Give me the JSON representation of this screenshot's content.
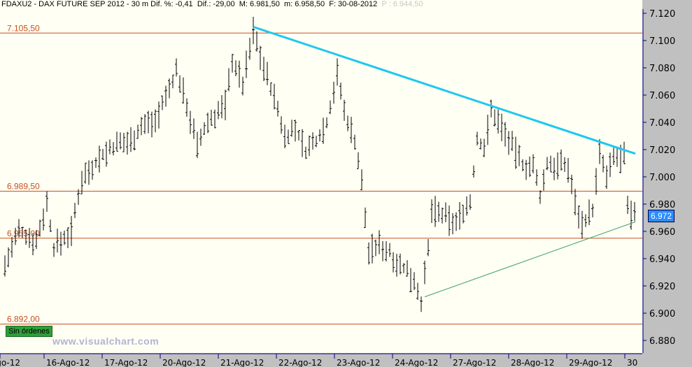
{
  "header": {
    "symbol": "FDAXU2 - DAX FUTURE  SEP 2012 -  30 m",
    "change_pct": "Dif. %: -0,41",
    "change": "Dif.: -29,00",
    "max": "M: 6.981,50",
    "min": "m: 6.958,50",
    "date": "F: 30-08-2012",
    "prev": "P : 6.944,50"
  },
  "orders_badge": "Sin órdenes",
  "watermark": "www.visualchart.com",
  "last_price": "6.972",
  "colors": {
    "bars": "#000000",
    "hline": "#c8501e",
    "resistance": "#1ec8f0",
    "support": "#2e9e5e",
    "bg": "#fffff4"
  },
  "chart_data": {
    "type": "ohlc",
    "ylim": [
      6875,
      7122
    ],
    "y_ticks": [
      {
        "v": 7120,
        "label": "7.120"
      },
      {
        "v": 7100,
        "label": "7.100"
      },
      {
        "v": 7080,
        "label": "7.080"
      },
      {
        "v": 7060,
        "label": "7.060"
      },
      {
        "v": 7040,
        "label": "7.040"
      },
      {
        "v": 7020,
        "label": "7.020"
      },
      {
        "v": 7000,
        "label": "7.000"
      },
      {
        "v": 6980,
        "label": "6.980"
      },
      {
        "v": 6960,
        "label": "6.960"
      },
      {
        "v": 6940,
        "label": "6.940"
      },
      {
        "v": 6920,
        "label": "6.920"
      },
      {
        "v": 6900,
        "label": "6.900"
      },
      {
        "v": 6880,
        "label": "6.880"
      }
    ],
    "x_range": [
      0,
      184
    ],
    "x_ticks": [
      {
        "bar": 0,
        "label": "Ago-12"
      },
      {
        "bar": 12.6,
        "label": "16-Ago-12"
      },
      {
        "bar": 29.2,
        "label": "17-Ago-12"
      },
      {
        "bar": 45.8,
        "label": "20-Ago-12"
      },
      {
        "bar": 62.4,
        "label": "21-Ago-12"
      },
      {
        "bar": 79,
        "label": "22-Ago-12"
      },
      {
        "bar": 95.6,
        "label": "23-Ago-12"
      },
      {
        "bar": 112.2,
        "label": "24-Ago-12"
      },
      {
        "bar": 128.8,
        "label": "27-Ago-12"
      },
      {
        "bar": 145.4,
        "label": "28-Ago-12"
      },
      {
        "bar": 162,
        "label": "29-Ago-12"
      },
      {
        "bar": 178.6,
        "label": "30"
      }
    ],
    "price_path": [
      [
        1,
        6935
      ],
      [
        5,
        6960
      ],
      [
        10,
        6953
      ],
      [
        13,
        6981
      ],
      [
        15,
        6948
      ],
      [
        20,
        6960
      ],
      [
        23,
        6999
      ],
      [
        28,
        7014
      ],
      [
        32,
        7022
      ],
      [
        37,
        7027
      ],
      [
        40,
        7037
      ],
      [
        44,
        7042
      ],
      [
        47,
        7058
      ],
      [
        50,
        7078
      ],
      [
        53,
        7053
      ],
      [
        56,
        7022
      ],
      [
        59,
        7040
      ],
      [
        64,
        7053
      ],
      [
        66,
        7086
      ],
      [
        69,
        7068
      ],
      [
        72,
        7107
      ],
      [
        75,
        7081
      ],
      [
        78,
        7058
      ],
      [
        81,
        7030
      ],
      [
        84,
        7035
      ],
      [
        87,
        7019
      ],
      [
        90,
        7027
      ],
      [
        93,
        7040
      ],
      [
        96,
        7076
      ],
      [
        98,
        7048
      ],
      [
        101,
        7027
      ],
      [
        103,
        6996
      ],
      [
        105,
        6945
      ],
      [
        108,
        6950
      ],
      [
        111,
        6945
      ],
      [
        114,
        6935
      ],
      [
        118,
        6925
      ],
      [
        120,
        6909
      ],
      [
        122,
        6945
      ],
      [
        123,
        6976
      ],
      [
        126,
        6971
      ],
      [
        130,
        6966
      ],
      [
        132,
        6976
      ],
      [
        134,
        6981
      ],
      [
        136,
        7027
      ],
      [
        138,
        7022
      ],
      [
        140,
        7048
      ],
      [
        143,
        7037
      ],
      [
        146,
        7022
      ],
      [
        149,
        7009
      ],
      [
        152,
        7007
      ],
      [
        154,
        6986
      ],
      [
        156,
        7009
      ],
      [
        159,
        7009
      ],
      [
        162,
        7007
      ],
      [
        164,
        6981
      ],
      [
        166,
        6966
      ],
      [
        169,
        6976
      ],
      [
        171,
        7017
      ],
      [
        173,
        6999
      ],
      [
        175,
        7014
      ],
      [
        178,
        7014
      ],
      [
        179,
        6976
      ],
      [
        180,
        6971
      ],
      [
        181,
        6976
      ]
    ],
    "horizontal_lines": [
      {
        "v": 7105.5,
        "label": "7.105,50"
      },
      {
        "v": 6989.5,
        "label": "6.989,50"
      },
      {
        "v": 6955,
        "label": "6.955,00"
      },
      {
        "v": 6892,
        "label": "6.892,00"
      }
    ],
    "trendlines": [
      {
        "name": "resistance",
        "from": [
          72.4,
          7110
        ],
        "to": [
          181.6,
          7017
        ]
      },
      {
        "name": "support",
        "from": [
          121.4,
          6912
        ],
        "to": [
          181.6,
          6967
        ]
      }
    ]
  }
}
